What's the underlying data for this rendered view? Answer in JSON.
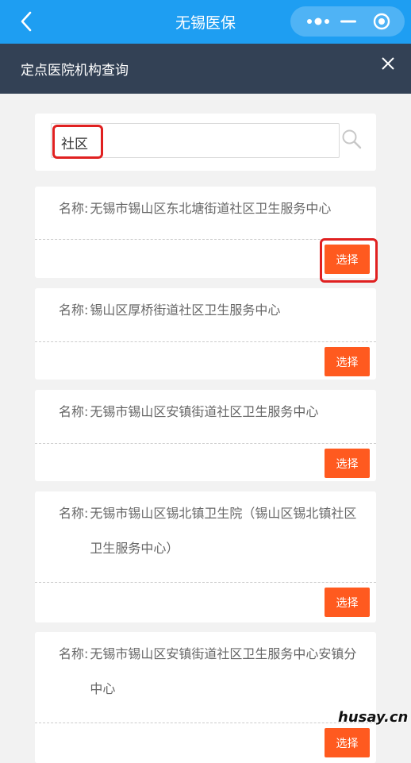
{
  "app": {
    "title": "无锡医保"
  },
  "capsule": {
    "more_icon": "more-dots-icon",
    "minimize_icon": "minimize-icon",
    "close_icon": "target-circle-icon"
  },
  "subheader": {
    "title": "定点医院机构查询",
    "close_icon": "close-icon"
  },
  "search": {
    "value": "社区",
    "icon": "search-icon"
  },
  "results": [
    {
      "label": "名称:",
      "name": "无锡市锡山区东北塘街道社区卫生服务中心",
      "button": "选择"
    },
    {
      "label": "名称:",
      "name": "锡山区厚桥街道社区卫生服务中心",
      "button": "选择"
    },
    {
      "label": "名称:",
      "name": "无锡市锡山区安镇街道社区卫生服务中心",
      "button": "选择"
    },
    {
      "label": "名称:",
      "name": "无锡市锡山区锡北镇卫生院（锡山区锡北镇社区卫生服务中心）",
      "button": "选择"
    },
    {
      "label": "名称:",
      "name": "无锡市锡山区安镇街道社区卫生服务中心安镇分中心",
      "button": "选择"
    }
  ],
  "watermark": "husay.cn",
  "colors": {
    "topbar": "#1e9ef2",
    "subheader": "#334155",
    "button": "#ff5a1f",
    "highlight": "#e02020"
  }
}
